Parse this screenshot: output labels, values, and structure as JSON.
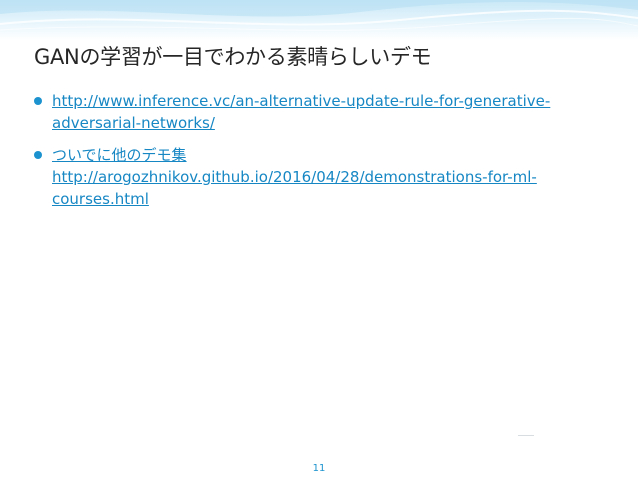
{
  "slide": {
    "title": "GANの学習が一目でわかる素晴らしいデモ",
    "bullets": [
      {
        "lines": [
          "http://www.inference.vc/an-alternative-update-rule-for-generative-",
          "adversarial-networks/"
        ]
      },
      {
        "lines": [
          "ついでに他のデモ集",
          "http://arogozhnikov.github.io/2016/04/28/demonstrations-for-ml-",
          "courses.html"
        ]
      }
    ],
    "page_number": "11"
  },
  "colors": {
    "accent": "#1c93cf",
    "link": "#1787c4",
    "title": "#262626",
    "header_band": "#c9e8f7"
  }
}
